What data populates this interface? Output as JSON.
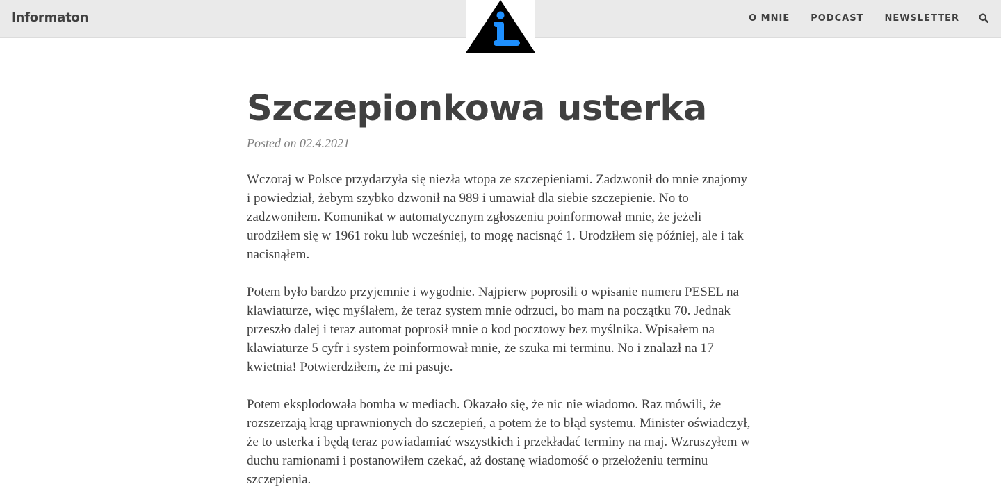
{
  "header": {
    "brand": "Informaton",
    "nav": [
      "O MNIE",
      "PODCAST",
      "NEWSLETTER"
    ],
    "search_icon": "search-icon",
    "logo": {
      "icon": "info-triangle-logo",
      "colors": {
        "triangle": "#000000",
        "letter": "#1e90ff"
      }
    }
  },
  "post": {
    "title": "Szczepionkowa usterka",
    "meta": "Posted on 02.4.2021",
    "paragraphs": [
      "Wczoraj w Polsce przydarzyła się niezła wtopa ze szczepieniami. Zadzwonił do mnie znajomy i powiedział, żebym szybko dzwonił na 989 i umawiał dla siebie szczepienie. No to zadzwoniłem. Komunikat w automatycznym zgłoszeniu poinformował mnie, że jeżeli urodziłem się w 1961 roku lub wcześniej, to mogę nacisnąć 1. Urodziłem się później, ale i tak nacisnąłem.",
      "Potem było bardzo przyjemnie i wygodnie. Najpierw poprosili o wpisanie numeru PESEL na klawiaturze, więc myślałem, że teraz system mnie odrzuci, bo mam na początku 70. Jednak przeszło dalej i teraz automat poprosił mnie o kod pocztowy bez myślnika. Wpisałem na klawiaturze 5 cyfr i system poinformował mnie, że szuka mi terminu. No i znalazł na 17 kwietnia! Potwierdziłem, że mi pasuje.",
      "Potem eksplodowała bomba w mediach. Okazało się, że nic nie wiadomo. Raz mówili, że rozszerzają krąg uprawnionych do szczepień, a potem że to błąd systemu. Minister oświadczył, że to usterka i będą teraz powiadamiać wszystkich i przekładać terminy na maj. Wzruszyłem w duchu ramionami i postanowiłem czekać, aż dostanę wiadomość o przełożeniu terminu szczepienia."
    ]
  }
}
